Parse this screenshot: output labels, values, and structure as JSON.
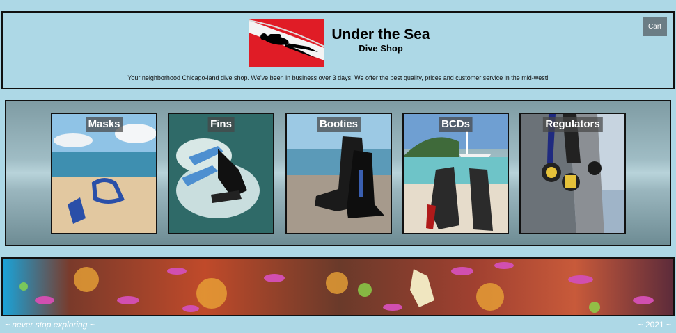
{
  "header": {
    "title": "Under the Sea",
    "subtitle": "Dive Shop",
    "tagline": "Your neighborhood Chicago-land dive shop. We've been in business over 3 days! We offer the best quality, prices and customer service in the mid-west!",
    "cart_label": "Cart"
  },
  "categories": [
    {
      "label": "Masks"
    },
    {
      "label": "Fins"
    },
    {
      "label": "Booties"
    },
    {
      "label": "BCDs"
    },
    {
      "label": "Regulators"
    }
  ],
  "footer": {
    "left": "~ never stop exploring ~",
    "right": "~ 2021 ~"
  },
  "colors": {
    "background": "#add8e6",
    "border": "#111111",
    "cart_button": "#6b7d85",
    "dive_flag_red": "#e8202a"
  }
}
